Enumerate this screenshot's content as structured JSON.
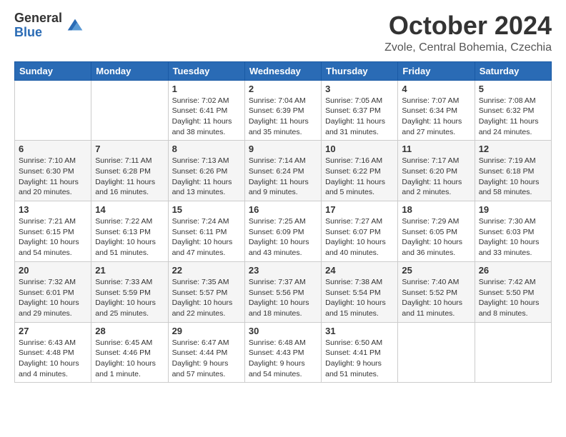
{
  "logo": {
    "general": "General",
    "blue": "Blue"
  },
  "header": {
    "month": "October 2024",
    "location": "Zvole, Central Bohemia, Czechia"
  },
  "weekdays": [
    "Sunday",
    "Monday",
    "Tuesday",
    "Wednesday",
    "Thursday",
    "Friday",
    "Saturday"
  ],
  "weeks": [
    [
      {
        "day": "",
        "sunrise": "",
        "sunset": "",
        "daylight": ""
      },
      {
        "day": "",
        "sunrise": "",
        "sunset": "",
        "daylight": ""
      },
      {
        "day": "1",
        "sunrise": "Sunrise: 7:02 AM",
        "sunset": "Sunset: 6:41 PM",
        "daylight": "Daylight: 11 hours and 38 minutes."
      },
      {
        "day": "2",
        "sunrise": "Sunrise: 7:04 AM",
        "sunset": "Sunset: 6:39 PM",
        "daylight": "Daylight: 11 hours and 35 minutes."
      },
      {
        "day": "3",
        "sunrise": "Sunrise: 7:05 AM",
        "sunset": "Sunset: 6:37 PM",
        "daylight": "Daylight: 11 hours and 31 minutes."
      },
      {
        "day": "4",
        "sunrise": "Sunrise: 7:07 AM",
        "sunset": "Sunset: 6:34 PM",
        "daylight": "Daylight: 11 hours and 27 minutes."
      },
      {
        "day": "5",
        "sunrise": "Sunrise: 7:08 AM",
        "sunset": "Sunset: 6:32 PM",
        "daylight": "Daylight: 11 hours and 24 minutes."
      }
    ],
    [
      {
        "day": "6",
        "sunrise": "Sunrise: 7:10 AM",
        "sunset": "Sunset: 6:30 PM",
        "daylight": "Daylight: 11 hours and 20 minutes."
      },
      {
        "day": "7",
        "sunrise": "Sunrise: 7:11 AM",
        "sunset": "Sunset: 6:28 PM",
        "daylight": "Daylight: 11 hours and 16 minutes."
      },
      {
        "day": "8",
        "sunrise": "Sunrise: 7:13 AM",
        "sunset": "Sunset: 6:26 PM",
        "daylight": "Daylight: 11 hours and 13 minutes."
      },
      {
        "day": "9",
        "sunrise": "Sunrise: 7:14 AM",
        "sunset": "Sunset: 6:24 PM",
        "daylight": "Daylight: 11 hours and 9 minutes."
      },
      {
        "day": "10",
        "sunrise": "Sunrise: 7:16 AM",
        "sunset": "Sunset: 6:22 PM",
        "daylight": "Daylight: 11 hours and 5 minutes."
      },
      {
        "day": "11",
        "sunrise": "Sunrise: 7:17 AM",
        "sunset": "Sunset: 6:20 PM",
        "daylight": "Daylight: 11 hours and 2 minutes."
      },
      {
        "day": "12",
        "sunrise": "Sunrise: 7:19 AM",
        "sunset": "Sunset: 6:18 PM",
        "daylight": "Daylight: 10 hours and 58 minutes."
      }
    ],
    [
      {
        "day": "13",
        "sunrise": "Sunrise: 7:21 AM",
        "sunset": "Sunset: 6:15 PM",
        "daylight": "Daylight: 10 hours and 54 minutes."
      },
      {
        "day": "14",
        "sunrise": "Sunrise: 7:22 AM",
        "sunset": "Sunset: 6:13 PM",
        "daylight": "Daylight: 10 hours and 51 minutes."
      },
      {
        "day": "15",
        "sunrise": "Sunrise: 7:24 AM",
        "sunset": "Sunset: 6:11 PM",
        "daylight": "Daylight: 10 hours and 47 minutes."
      },
      {
        "day": "16",
        "sunrise": "Sunrise: 7:25 AM",
        "sunset": "Sunset: 6:09 PM",
        "daylight": "Daylight: 10 hours and 43 minutes."
      },
      {
        "day": "17",
        "sunrise": "Sunrise: 7:27 AM",
        "sunset": "Sunset: 6:07 PM",
        "daylight": "Daylight: 10 hours and 40 minutes."
      },
      {
        "day": "18",
        "sunrise": "Sunrise: 7:29 AM",
        "sunset": "Sunset: 6:05 PM",
        "daylight": "Daylight: 10 hours and 36 minutes."
      },
      {
        "day": "19",
        "sunrise": "Sunrise: 7:30 AM",
        "sunset": "Sunset: 6:03 PM",
        "daylight": "Daylight: 10 hours and 33 minutes."
      }
    ],
    [
      {
        "day": "20",
        "sunrise": "Sunrise: 7:32 AM",
        "sunset": "Sunset: 6:01 PM",
        "daylight": "Daylight: 10 hours and 29 minutes."
      },
      {
        "day": "21",
        "sunrise": "Sunrise: 7:33 AM",
        "sunset": "Sunset: 5:59 PM",
        "daylight": "Daylight: 10 hours and 25 minutes."
      },
      {
        "day": "22",
        "sunrise": "Sunrise: 7:35 AM",
        "sunset": "Sunset: 5:57 PM",
        "daylight": "Daylight: 10 hours and 22 minutes."
      },
      {
        "day": "23",
        "sunrise": "Sunrise: 7:37 AM",
        "sunset": "Sunset: 5:56 PM",
        "daylight": "Daylight: 10 hours and 18 minutes."
      },
      {
        "day": "24",
        "sunrise": "Sunrise: 7:38 AM",
        "sunset": "Sunset: 5:54 PM",
        "daylight": "Daylight: 10 hours and 15 minutes."
      },
      {
        "day": "25",
        "sunrise": "Sunrise: 7:40 AM",
        "sunset": "Sunset: 5:52 PM",
        "daylight": "Daylight: 10 hours and 11 minutes."
      },
      {
        "day": "26",
        "sunrise": "Sunrise: 7:42 AM",
        "sunset": "Sunset: 5:50 PM",
        "daylight": "Daylight: 10 hours and 8 minutes."
      }
    ],
    [
      {
        "day": "27",
        "sunrise": "Sunrise: 6:43 AM",
        "sunset": "Sunset: 4:48 PM",
        "daylight": "Daylight: 10 hours and 4 minutes."
      },
      {
        "day": "28",
        "sunrise": "Sunrise: 6:45 AM",
        "sunset": "Sunset: 4:46 PM",
        "daylight": "Daylight: 10 hours and 1 minute."
      },
      {
        "day": "29",
        "sunrise": "Sunrise: 6:47 AM",
        "sunset": "Sunset: 4:44 PM",
        "daylight": "Daylight: 9 hours and 57 minutes."
      },
      {
        "day": "30",
        "sunrise": "Sunrise: 6:48 AM",
        "sunset": "Sunset: 4:43 PM",
        "daylight": "Daylight: 9 hours and 54 minutes."
      },
      {
        "day": "31",
        "sunrise": "Sunrise: 6:50 AM",
        "sunset": "Sunset: 4:41 PM",
        "daylight": "Daylight: 9 hours and 51 minutes."
      },
      {
        "day": "",
        "sunrise": "",
        "sunset": "",
        "daylight": ""
      },
      {
        "day": "",
        "sunrise": "",
        "sunset": "",
        "daylight": ""
      }
    ]
  ]
}
